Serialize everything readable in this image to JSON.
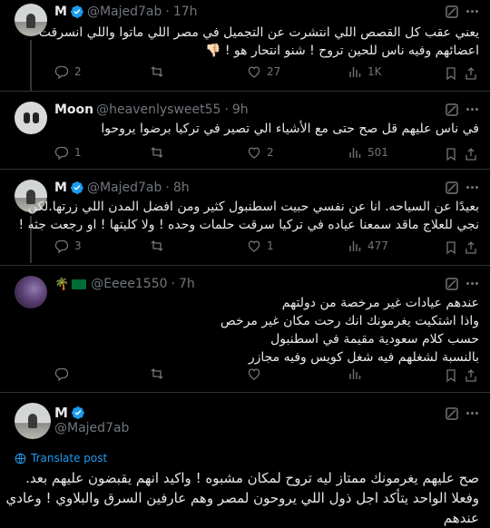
{
  "tweets": [
    {
      "name": "M",
      "handle": "@Majed7ab",
      "time": "17h",
      "lines": [
        "يعني عقب كل القصص اللي انتشرت عن التجميل في مصر اللي ماتوا واللي انسرقت",
        "اعضائهم وفيه ناس للحين تروح ! شنو انتحار هو ! 👎🏻"
      ],
      "replies": "2",
      "likes": "27",
      "views": "1K"
    },
    {
      "name": "Moon",
      "handle": "@heavenlysweet55",
      "time": "9h",
      "lines": [
        "في ناس عليهم قل صح حتى مع الأشياء الي تصير في تركيا برضوا يروحوا"
      ],
      "replies": "1",
      "likes": "2",
      "views": "501"
    },
    {
      "name": "M",
      "handle": "@Majed7ab",
      "time": "8h",
      "lines": [
        "بعيدًا عن السياحه. انا عن نفسي حبيت اسطنبول كثير ومن افضل المدن اللي زرتها.لكن",
        "نجي للعلاج ماقد سمعنا عياده في تركيا سرقت حلمات وحده ! ولا كليتها ! او رجعت جثه !"
      ],
      "replies": "3",
      "likes": "1",
      "views": "477"
    },
    {
      "name": "",
      "handle": "@Eeee1550",
      "time": "7h",
      "lines": [
        "عندهم عيادات غير مرخصة من دولتهم",
        "واذا اشتكيت يغرمونك انك رحت مكان غير مرخص",
        "حسب كلام سعودية مقيمة في اسطنبول",
        "بالنسبة لشغلهم فيه شغل كويس وفيه مجازر"
      ],
      "replies": "",
      "likes": "",
      "views": ""
    }
  ],
  "main_tweet": {
    "name": "M",
    "handle": "@Majed7ab",
    "translate": "Translate post",
    "lines": [
      "صح عليهم يغرمونك ممتاز ليه تروح لمكان مشبوه ! واكيد انهم يقبضون عليهم بعد.",
      "وفعلا الواحد يتأكد اجل ذول اللي يروحون لمصر وهم عارفين السرق والبلاوي ! وعادي",
      "عندهم"
    ]
  },
  "colors": {
    "background": "#000000",
    "text": "#e7e9ea",
    "muted": "#71767b",
    "accent": "#1d9bf0"
  }
}
